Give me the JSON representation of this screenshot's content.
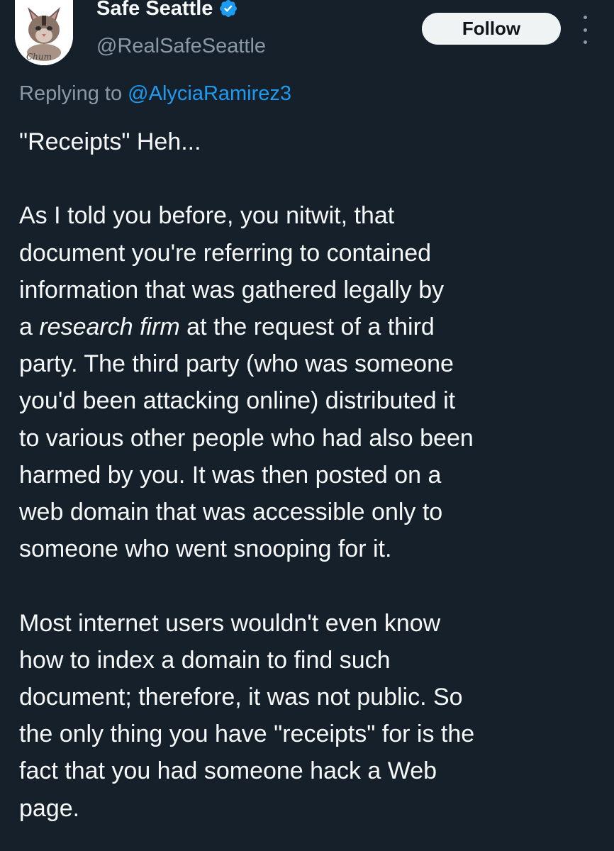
{
  "author": {
    "display_name": "Safe Seattle",
    "handle": "@RealSafeSeattle",
    "avatar_label": "Chum",
    "verified_icon": "verified-badge-icon"
  },
  "actions": {
    "follow_label": "Follow",
    "more_icon": "more-vertical-icon"
  },
  "reply": {
    "prefix": "Replying to ",
    "to_handle": "@AlyciaRamirez3"
  },
  "tweet": {
    "line_1": "\"Receipts\" Heh...",
    "p2": {
      "l1": "As I told you before, you nitwit, that",
      "l2": "document you're referring to contained",
      "l3": "information that was gathered legally by",
      "l4_pre": "a ",
      "l4_em": "research firm",
      "l4_post": " at the request of a third",
      "l5": "party. The third party (who was someone",
      "l6": "you'd been attacking online) distributed it",
      "l7": "to various other people who had also been",
      "l8": "harmed by you. It was then posted on a",
      "l9": "web domain that was accessible only to",
      "l10": "someone who went snooping for it."
    },
    "p3": {
      "l1": "Most internet users wouldn't even know",
      "l2": "how to index a domain to find such",
      "l3": "document; therefore, it was not public. So",
      "l4": "the only thing you have \"receipts\" for is the",
      "l5": "fact that you had someone hack a Web",
      "l6": "page."
    }
  },
  "colors": {
    "background": "#15202b",
    "text": "#f7f9f9",
    "muted": "#8b98a5",
    "link": "#1d9bf0",
    "follow_bg": "#eff3f4"
  }
}
